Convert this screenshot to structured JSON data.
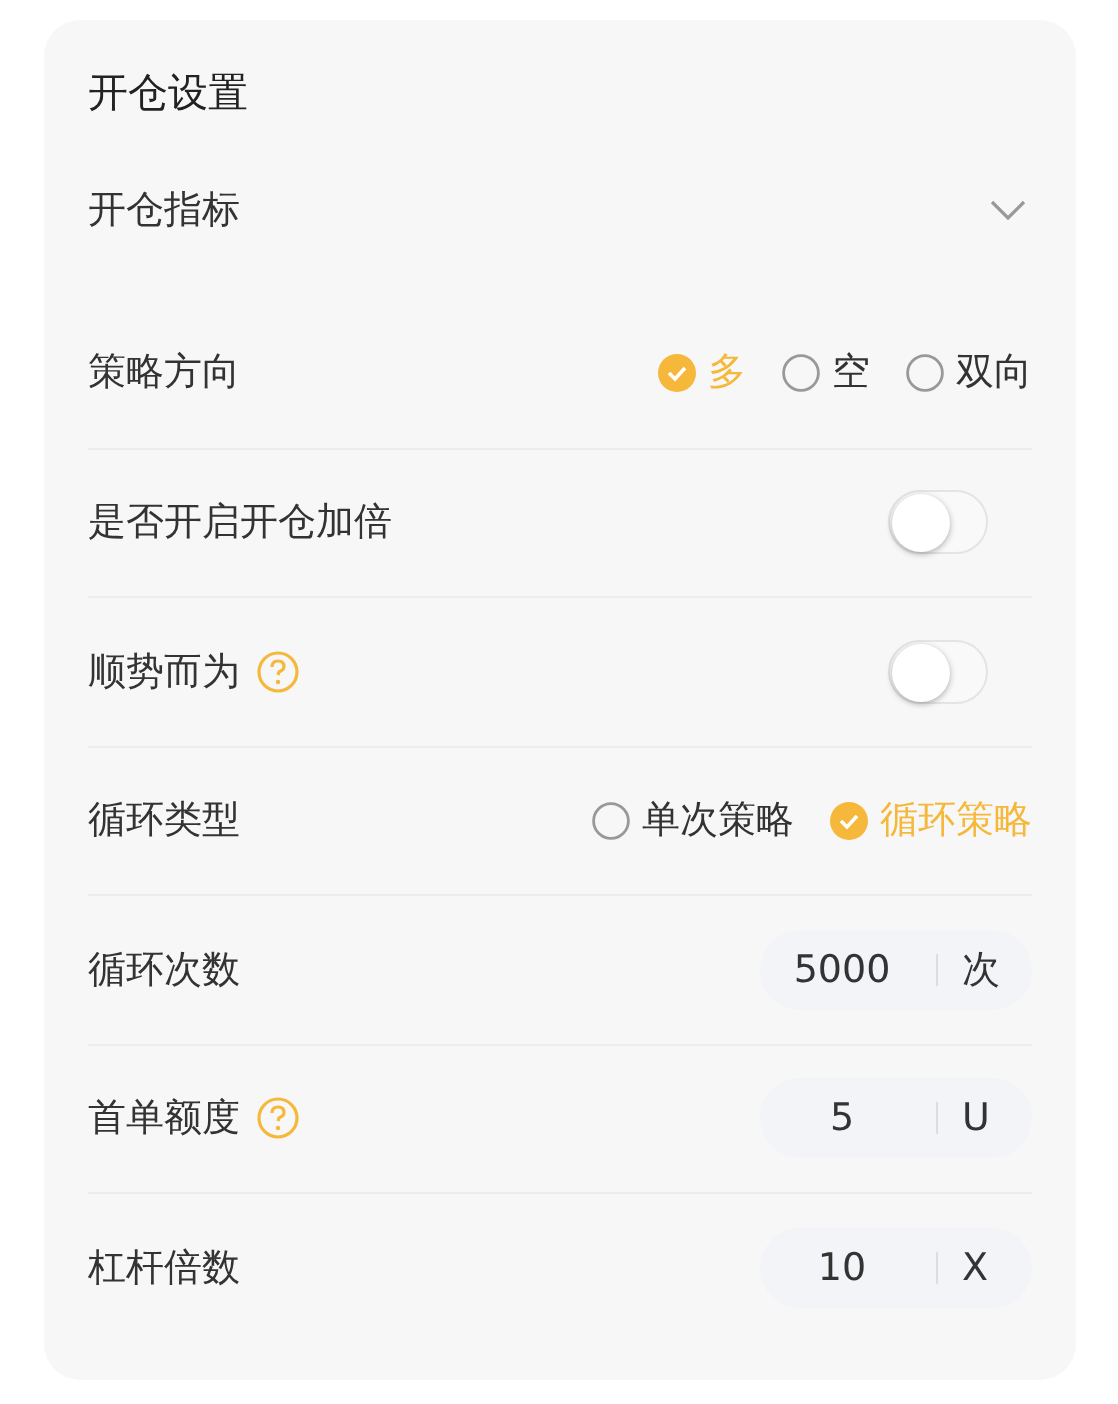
{
  "title": "开仓设置",
  "indicator": {
    "label": "开仓指标",
    "expanded": false
  },
  "rows": [
    {
      "kind": "radio",
      "label": "策略方向",
      "help": false,
      "options": [
        {
          "label": "多",
          "selected": true
        },
        {
          "label": "空",
          "selected": false
        },
        {
          "label": "双向",
          "selected": false
        }
      ]
    },
    {
      "kind": "toggle",
      "label": "是否开启开仓加倍",
      "help": false,
      "on": false
    },
    {
      "kind": "toggle",
      "label": "顺势而为",
      "help": true,
      "on": false
    },
    {
      "kind": "radio",
      "label": "循环类型",
      "help": false,
      "options": [
        {
          "label": "单次策略",
          "selected": false
        },
        {
          "label": "循环策略",
          "selected": true
        }
      ]
    },
    {
      "kind": "input",
      "label": "循环次数",
      "help": false,
      "value": "5000",
      "unit": "次"
    },
    {
      "kind": "input",
      "label": "首单额度",
      "help": true,
      "value": "5",
      "unit": "U"
    },
    {
      "kind": "input",
      "label": "杠杆倍数",
      "help": false,
      "value": "10",
      "unit": "X"
    }
  ]
}
